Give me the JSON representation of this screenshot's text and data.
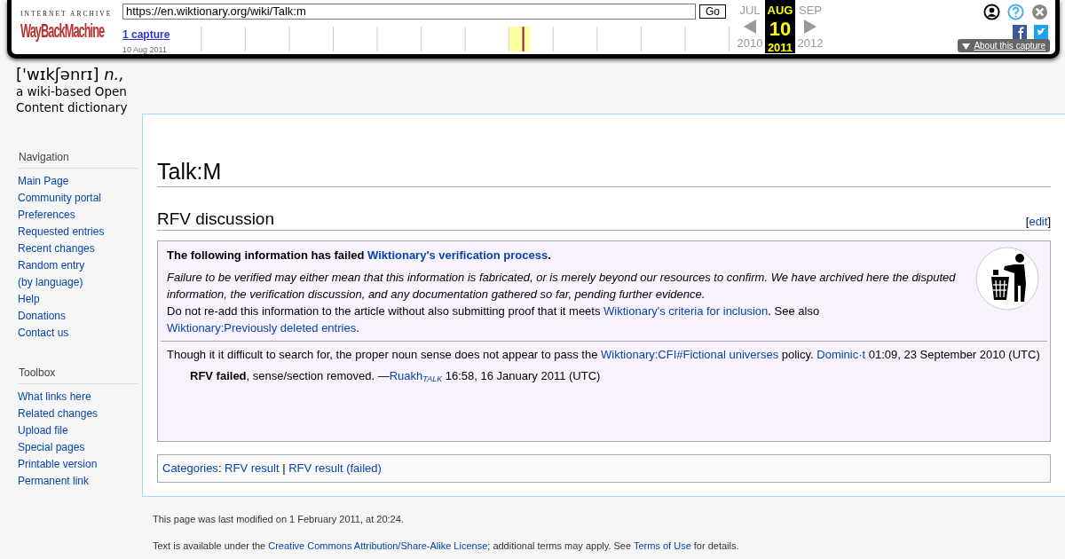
{
  "wayback": {
    "archive": "INTERNET ARCHIVE",
    "machine": "WayBackMachine",
    "url": "https://en.wiktionary.org/wiki/Talk:m",
    "go": "Go",
    "captures": "1 capture",
    "capture_date": "10 Aug 2011",
    "months": [
      {
        "label": "JUL",
        "selected": false
      },
      {
        "label": "AUG",
        "selected": true
      },
      {
        "label": "SEP",
        "selected": false
      }
    ],
    "day": "10",
    "years": [
      {
        "label": "2010",
        "selected": false
      },
      {
        "label": "2011",
        "selected": true
      },
      {
        "label": "2012",
        "selected": false
      }
    ],
    "about": "About this capture"
  },
  "logo": {
    "pron": "['wɪkʃənrɪ]",
    "pos": "n.,",
    "lines": [
      "a wiki-based Open",
      "Content dictionary"
    ]
  },
  "sidebar": [
    {
      "heading": "Navigation",
      "items": [
        "Main Page",
        "Community portal",
        "Preferences",
        "Requested entries",
        "Recent changes",
        "Random entry",
        "(by language)",
        "Help",
        "Donations",
        "Contact us"
      ]
    },
    {
      "heading": "Toolbox",
      "items": [
        "What links here",
        "Related changes",
        "Upload file",
        "Special pages",
        "Printable version",
        "Permanent link"
      ]
    }
  ],
  "page": {
    "title": "Talk:M",
    "section": "RFV discussion",
    "edit": [
      {
        "text": "["
      },
      {
        "text": "edit",
        "kind": "link"
      },
      {
        "text": "]"
      }
    ],
    "notice": {
      "heading": [
        {
          "text": "The following information has failed "
        },
        {
          "text": "Wiktionary's verification process",
          "kind": "link"
        },
        {
          "text": "."
        }
      ],
      "explanation": "Failure to be verified may either mean that this information is fabricated, or is merely beyond our resources to confirm. We have archived here the disputed information, the verification discussion, and any documentation gathered so far, pending further evidence.",
      "instruction": [
        {
          "text": "Do not re-add this information to the article without also submitting proof that it meets "
        },
        {
          "text": "Wiktionary's criteria for inclusion",
          "kind": "link"
        },
        {
          "text": ". See also "
        },
        {
          "text": "Wiktionary:Previously deleted entries",
          "kind": "link"
        },
        {
          "text": "."
        }
      ]
    },
    "comments": [
      {
        "parts": [
          {
            "text": "Though it it difficult to search for, the proper noun sense does not appear to pass the "
          },
          {
            "text": "Wiktionary:CFI#Fictional universes",
            "kind": "link"
          },
          {
            "text": " policy. "
          },
          {
            "text": "Dominic·t",
            "kind": "link"
          },
          {
            "text": " 01:09, 23 September 2010 (UTC)"
          }
        ],
        "children": [
          {
            "parts": [
              {
                "text": "RFV failed",
                "kind": "bold"
              },
              {
                "text": ", sense/section removed. —"
              },
              {
                "text": "Ruakh",
                "kind": "link"
              },
              {
                "text": "TALK",
                "kind": "sublink"
              },
              {
                "text": " 16:58, 16 January 2011 (UTC)"
              }
            ]
          }
        ]
      }
    ],
    "categories": [
      {
        "text": "Categories",
        "kind": "link"
      },
      {
        "text": ": "
      },
      {
        "text": "RFV result",
        "kind": "link"
      },
      {
        "text": " | "
      },
      {
        "text": "RFV result (failed)",
        "kind": "link"
      }
    ]
  },
  "footer": {
    "modified": "This page was last modified on 1 February 2011, at 20:24.",
    "license": [
      {
        "text": "Text is available under the "
      },
      {
        "text": "Creative Commons Attribution/Share-Alike License",
        "kind": "link"
      },
      {
        "text": "; additional terms may apply. See "
      },
      {
        "text": "Terms of Use",
        "kind": "link"
      },
      {
        "text": " for details."
      }
    ]
  }
}
